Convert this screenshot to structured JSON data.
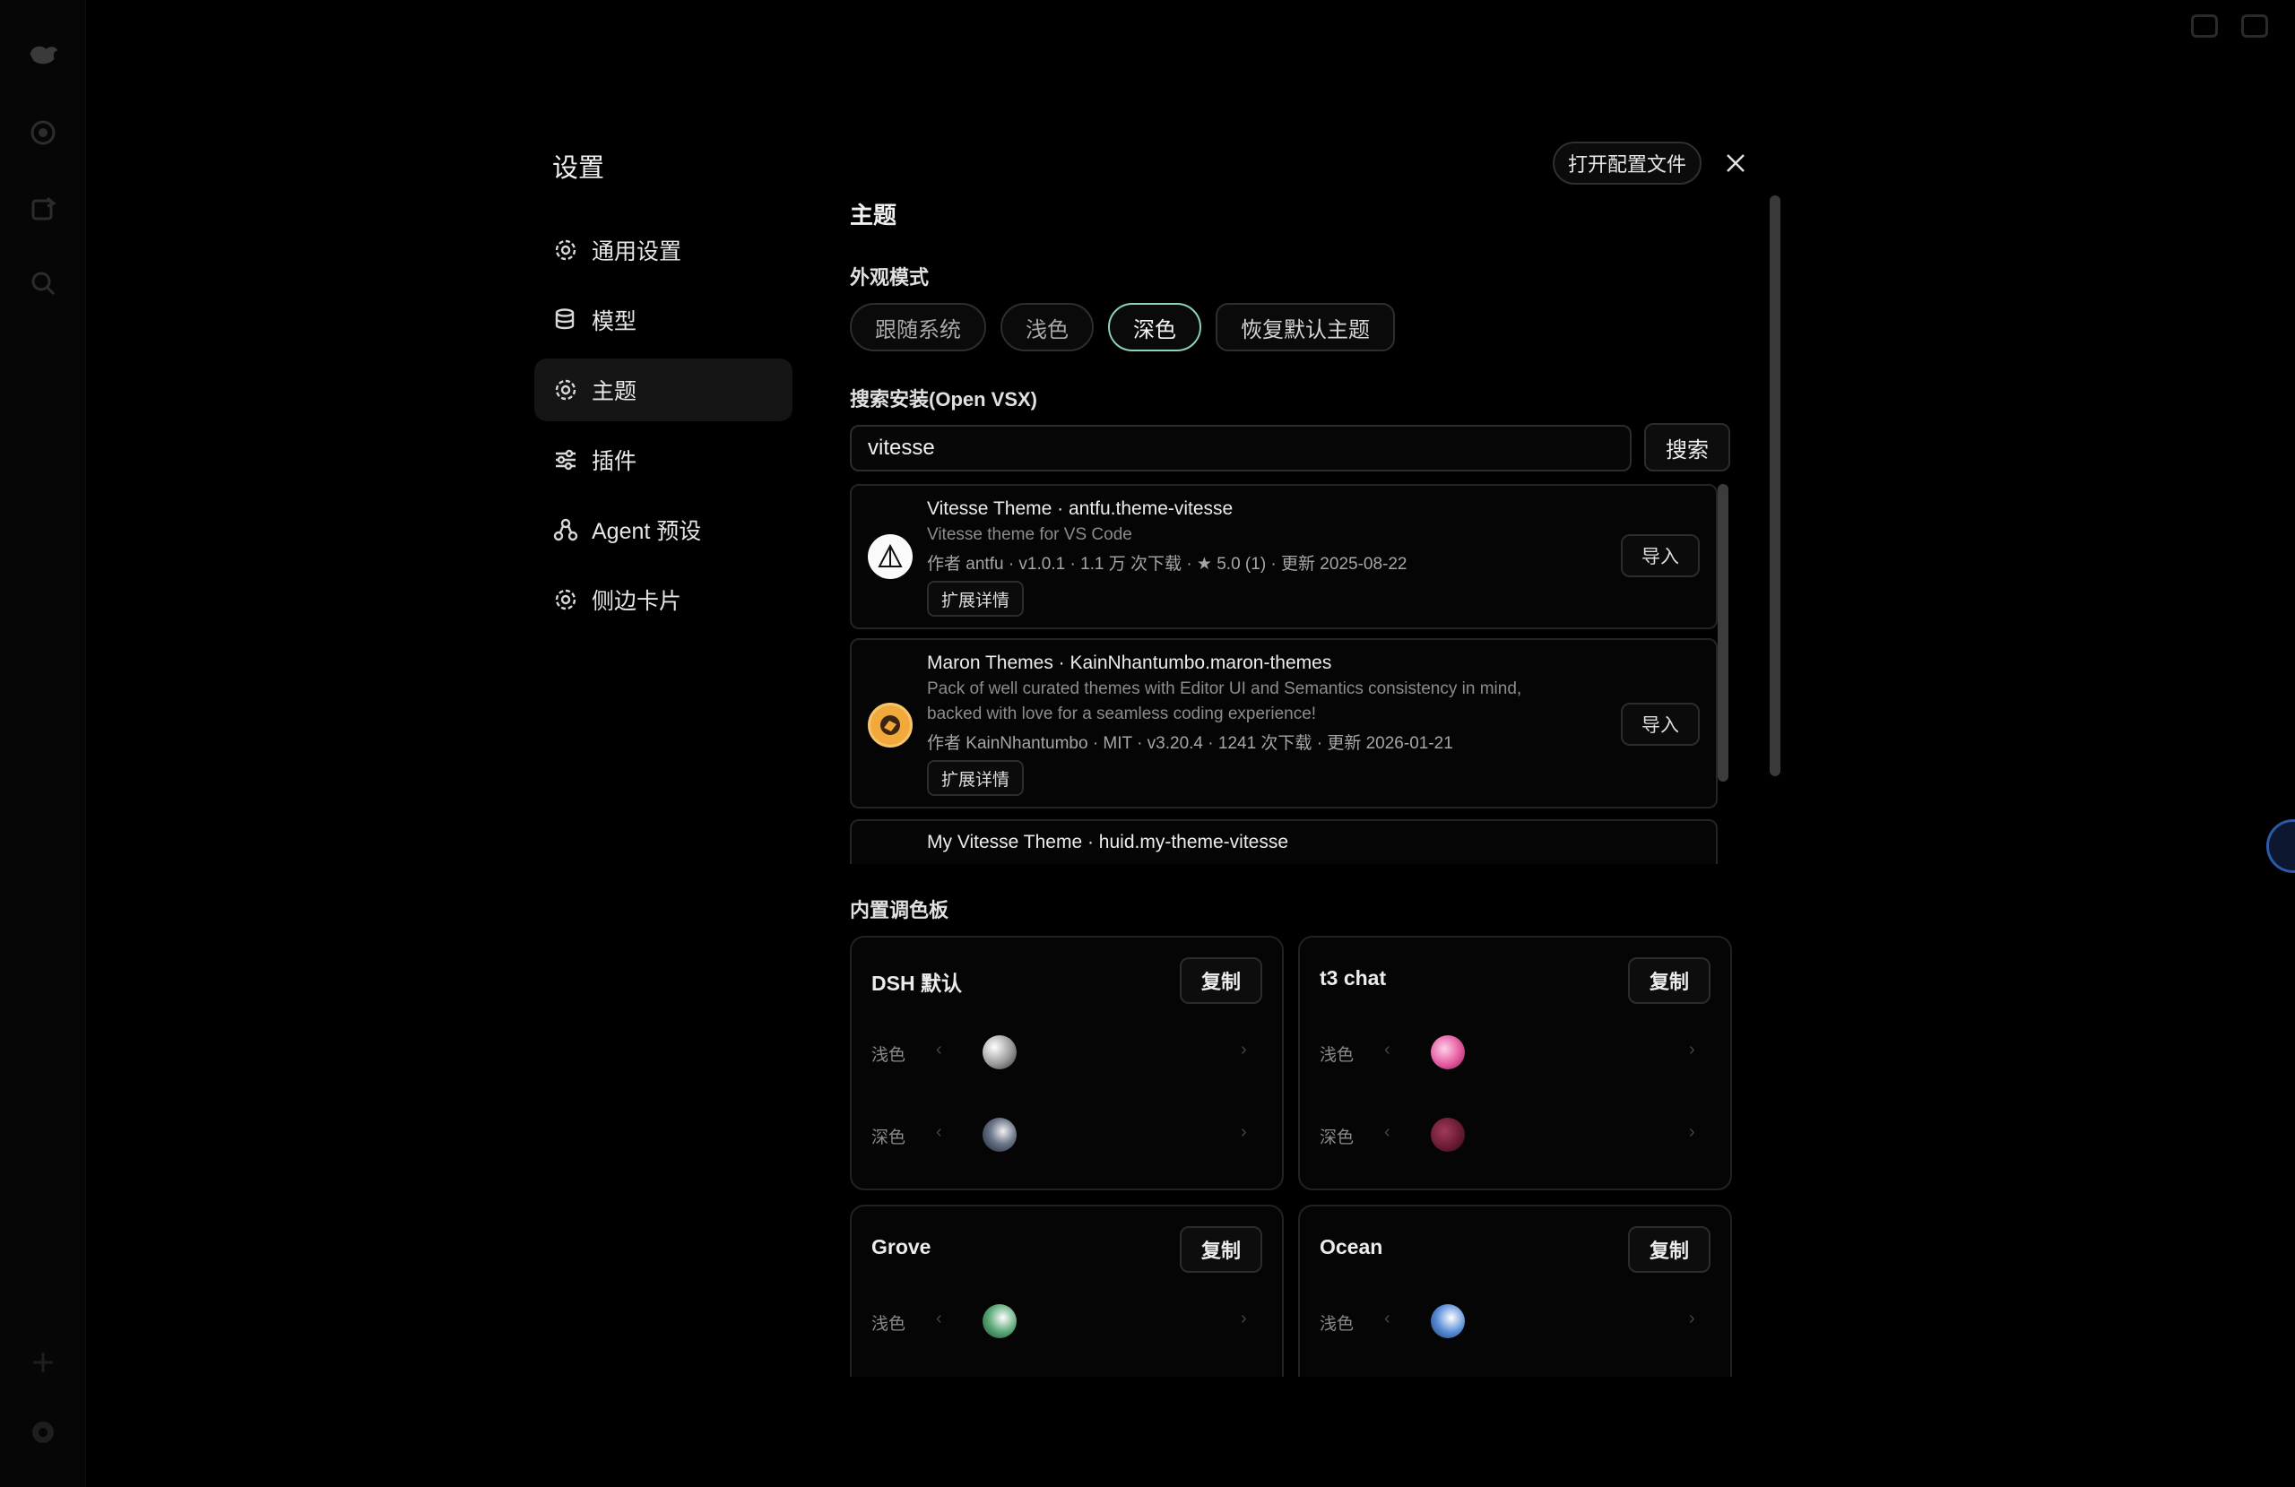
{
  "settings": {
    "title": "设置",
    "open_config": "打开配置文件"
  },
  "nav": {
    "items": [
      {
        "label": "通用设置",
        "icon": "gear-icon"
      },
      {
        "label": "模型",
        "icon": "database-icon"
      },
      {
        "label": "主题",
        "icon": "gear-icon",
        "active": true
      },
      {
        "label": "插件",
        "icon": "sliders-icon"
      },
      {
        "label": "Agent 预设",
        "icon": "agent-icon"
      },
      {
        "label": "侧边卡片",
        "icon": "gear-icon"
      }
    ]
  },
  "theme": {
    "heading": "主题",
    "appearance_label": "外观模式",
    "modes": [
      "跟随系统",
      "浅色",
      "深色"
    ],
    "active_mode": "深色",
    "reset": "恢复默认主题",
    "search_label": "搜索安装(Open VSX)",
    "search_value": "vitesse",
    "search_button": "搜索"
  },
  "extensions": [
    {
      "title": "Vitesse Theme · antfu.theme-vitesse",
      "desc": [
        "Vitesse theme for VS Code"
      ],
      "meta": "作者 antfu · v1.0.1 · 1.1 万 次下载 · ★ 5.0 (1) · 更新 2025-08-22",
      "detail": "扩展详情",
      "import": "导入"
    },
    {
      "title": "Maron Themes · KainNhantumbo.maron-themes",
      "desc": [
        "Pack of well curated themes with Editor UI and Semantics consistency in mind,",
        "backed with love for a seamless coding experience!"
      ],
      "meta": "作者 KainNhantumbo · MIT · v3.20.4 · 1241 次下载 · 更新 2026-01-21",
      "detail": "扩展详情",
      "import": "导入"
    },
    {
      "title": "My Vitesse Theme · huid.my-theme-vitesse"
    }
  ],
  "palettes_heading": "内置调色板",
  "palettes": [
    {
      "name": "DSH 默认",
      "copy": "复制",
      "rows": [
        {
          "label": "浅色",
          "color": "#d8d8d8"
        },
        {
          "label": "深色",
          "color": "#5a6478"
        }
      ]
    },
    {
      "name": "t3 chat",
      "copy": "复制",
      "rows": [
        {
          "label": "浅色",
          "color": "#e86aa8"
        },
        {
          "label": "深色",
          "color": "#7a2440"
        }
      ]
    },
    {
      "name": "Grove",
      "copy": "复制",
      "rows": [
        {
          "label": "浅色",
          "color": "#5aa878"
        }
      ]
    },
    {
      "name": "Ocean",
      "copy": "复制",
      "rows": [
        {
          "label": "浅色",
          "color": "#5a8fd8"
        }
      ]
    }
  ],
  "arrows": {
    "left": "‹",
    "right": "›"
  }
}
